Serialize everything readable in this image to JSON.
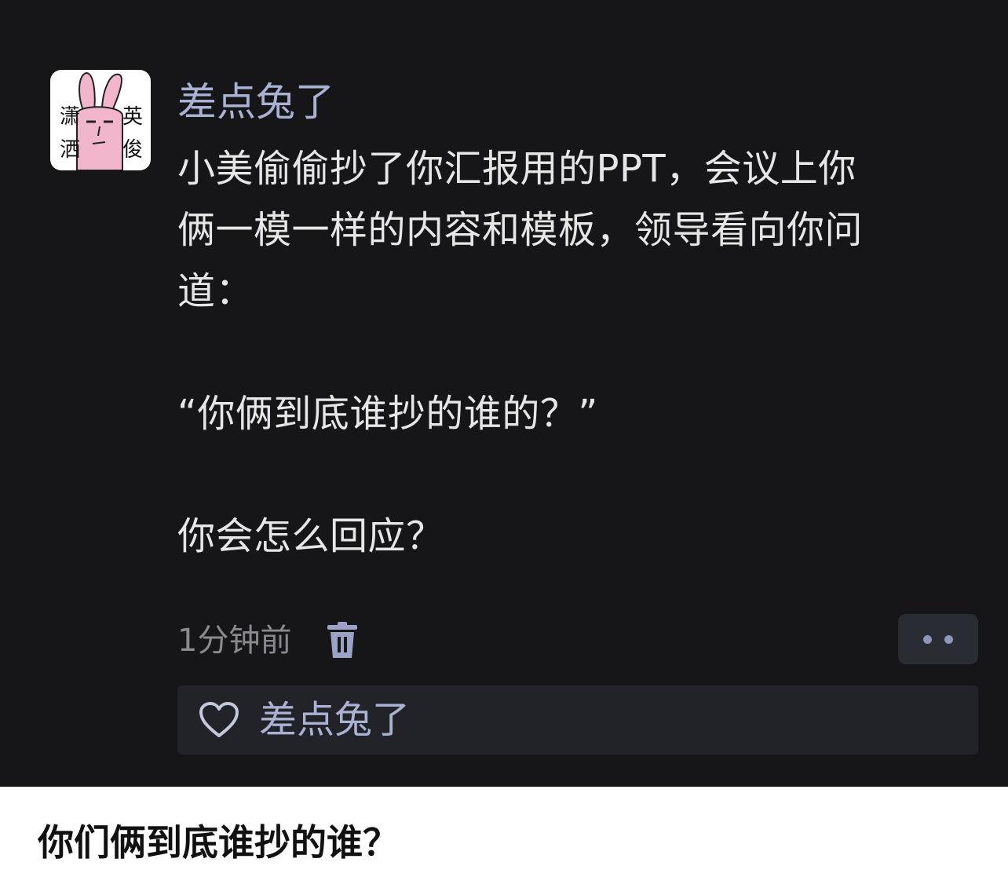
{
  "post": {
    "author": "差点兔了",
    "avatar_text": [
      "潇",
      "洒",
      "英",
      "俊"
    ],
    "body": "小美偷偷抄了你汇报用的PPT，会议上你\n俩一模一样的内容和模板，领导看向你问\n道：\n\n“你俩到底谁抄的谁的？”\n\n你会怎么回应？",
    "time": "1分钟前",
    "icons": {
      "delete": "trash-icon",
      "more": "more-dots-icon",
      "like": "heart-icon"
    }
  },
  "likes": {
    "names": "差点兔了"
  },
  "caption": {
    "text": "你们俩到底谁抄的谁？"
  },
  "colors": {
    "background": "#161618",
    "username": "#aab2d4",
    "body_text": "#e6e6e6",
    "muted_text": "#8a8a8e",
    "avatar_pink": "#f2b6cc"
  }
}
